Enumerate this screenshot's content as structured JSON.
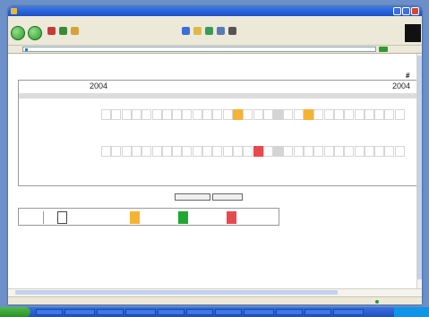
{
  "window": {
    "title": "",
    "accent": "#1a4fc9",
    "close_color": "#d9472b"
  },
  "menubar": {
    "items": [
      "",
      "",
      "",
      "",
      "",
      ""
    ]
  },
  "toolbar": {
    "watermark": ""
  },
  "addressbar": {
    "label": "",
    "url": "",
    "go": "",
    "links": ""
  },
  "page": {
    "hash": "#",
    "year_left": "2004",
    "year_right": "2004",
    "link_text": "",
    "current_date": "",
    "header_label": "",
    "days": [
      "",
      "",
      "",
      "",
      "",
      "",
      "",
      "",
      "",
      "",
      "",
      "",
      "",
      "",
      "",
      "",
      "",
      "",
      "",
      "",
      "",
      "",
      "",
      "",
      "",
      "",
      "",
      "",
      "",
      ""
    ],
    "properties": [
      {
        "name": "",
        "row_label": "",
        "cells": [
          "",
          "",
          "",
          "",
          "",
          "",
          "",
          "",
          "",
          "",
          "",
          "",
          "",
          "orange",
          "",
          "",
          "",
          "selected",
          "",
          "",
          "orange",
          "",
          "",
          "",
          "",
          "",
          "",
          "",
          "",
          ""
        ]
      },
      {
        "name": "",
        "row_label": "",
        "cells": [
          "",
          "",
          "",
          "",
          "",
          "",
          "",
          "",
          "",
          "",
          "",
          "",
          "",
          "",
          "",
          "red",
          "",
          "selected",
          "",
          "",
          "",
          "",
          "",
          "",
          "",
          "",
          "",
          "",
          "",
          ""
        ]
      }
    ],
    "pager": {
      "prev": "",
      "next": ""
    },
    "legend": {
      "title": "",
      "items": [
        {
          "label": "",
          "color": "#ffffff"
        },
        {
          "label": "",
          "color": "#f5b335"
        },
        {
          "label": "",
          "color": "#1ea832"
        },
        {
          "label": "",
          "color": "#e8494e"
        }
      ]
    },
    "cell_colors": {
      "orange": "#f5b335",
      "red": "#e8494e",
      "selected": "#d4d4d4"
    }
  },
  "statusbar": {
    "text": "",
    "zone": ""
  },
  "taskbar": {
    "start": "",
    "tasks": [
      "",
      "",
      "",
      "",
      "",
      "",
      "",
      "",
      "",
      "",
      ""
    ],
    "clock": ""
  }
}
